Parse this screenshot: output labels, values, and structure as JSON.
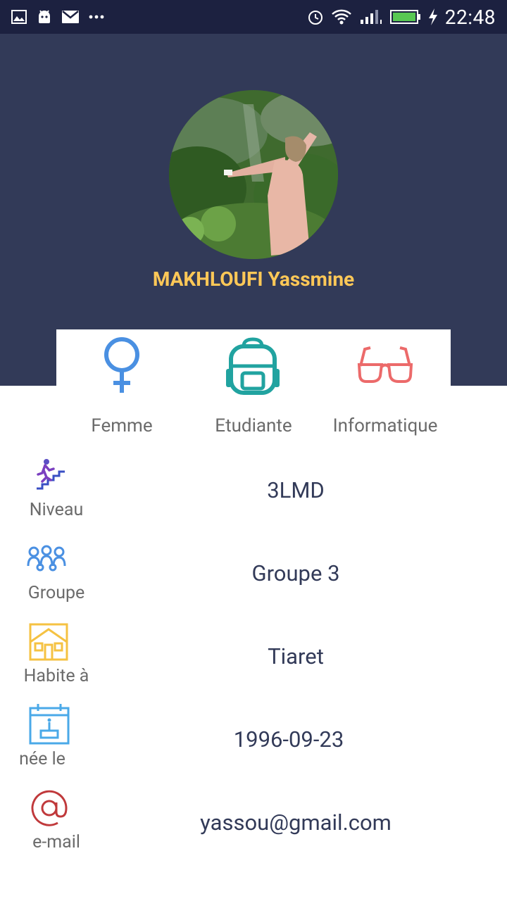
{
  "status_bar": {
    "time": "22:48",
    "left_icons": [
      "image-icon",
      "android-icon",
      "mail-icon",
      "more-icon"
    ],
    "right_icons": [
      "alarm-icon",
      "wifi-icon",
      "signal-icon",
      "battery-icon",
      "charging-icon"
    ]
  },
  "profile": {
    "name": "MAKHLOUFI Yassmine",
    "avatar": "profile-photo"
  },
  "tags": [
    {
      "label": "Femme",
      "icon": "female-icon",
      "color": "#4a90e2"
    },
    {
      "label": "Etudiante",
      "icon": "backpack-icon",
      "color": "#21a3a0"
    },
    {
      "label": "Informatique",
      "icon": "glasses-icon",
      "color": "#ec6a6a"
    }
  ],
  "details": [
    {
      "label": "Niveau",
      "value": "3LMD",
      "icon": "stairs-icon"
    },
    {
      "label": "Groupe",
      "value": "Groupe 3",
      "icon": "group-icon"
    },
    {
      "label": "Habite à",
      "value": "Tiaret",
      "icon": "house-icon"
    },
    {
      "label": "née le",
      "value": "1996-09-23",
      "icon": "calendar-cake-icon"
    },
    {
      "label": "e-mail",
      "value": "yassou@gmail.com",
      "icon": "at-icon"
    }
  ],
  "colors": {
    "status_bar": "#1c2140",
    "header": "#323a58",
    "name": "#ffc857",
    "value_text": "#323a58",
    "label_text": "#6b6b6b"
  }
}
